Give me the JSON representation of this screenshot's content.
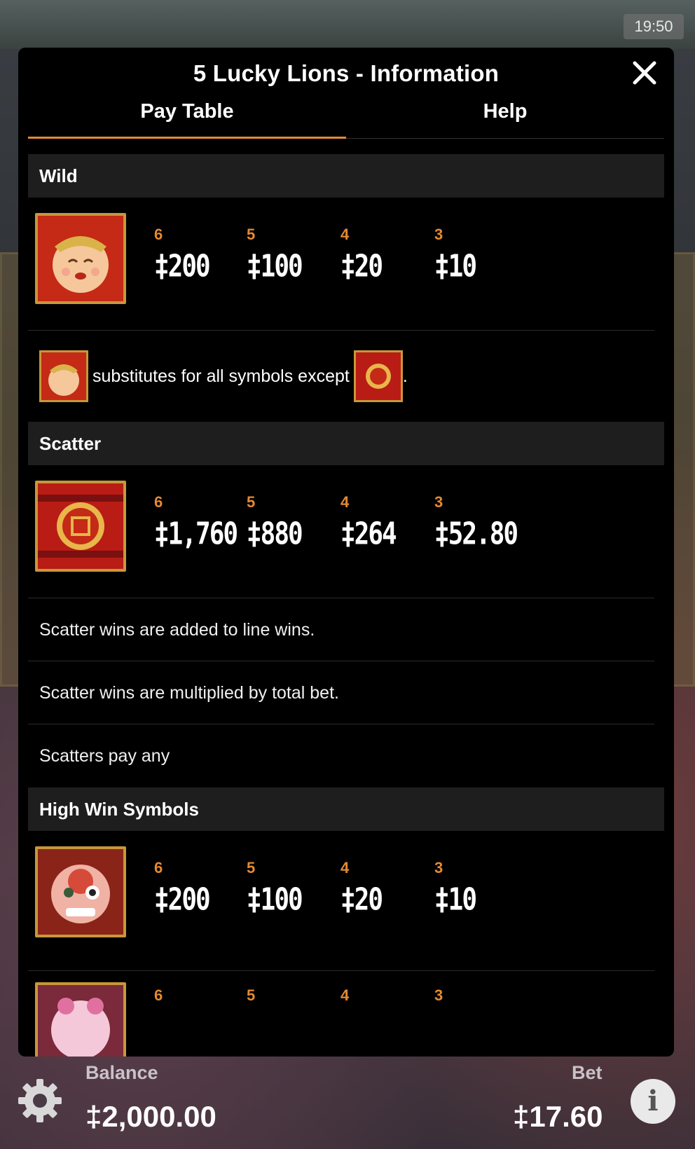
{
  "status_bar": {
    "time": "19:50"
  },
  "dialog": {
    "title": "5 Lucky Lions - Information",
    "tabs": [
      {
        "label": "Pay Table"
      },
      {
        "label": "Help"
      }
    ]
  },
  "sections": {
    "wild": {
      "heading": "Wild",
      "counts": [
        "6",
        "5",
        "4",
        "3"
      ],
      "values": [
        "‡200",
        "‡100",
        "‡20",
        "‡10"
      ],
      "note": "substitutes for all symbols except",
      "note_end": "."
    },
    "scatter": {
      "heading": "Scatter",
      "counts": [
        "6",
        "5",
        "4",
        "3"
      ],
      "values": [
        "‡1,760",
        "‡880",
        "‡264",
        "‡52.80"
      ],
      "notes": [
        "Scatter wins are added to line wins.",
        "Scatter wins are multiplied by total bet.",
        "Scatters pay any"
      ]
    },
    "high_win": {
      "heading": "High Win Symbols",
      "rows": [
        {
          "counts": [
            "6",
            "5",
            "4",
            "3"
          ],
          "values": [
            "‡200",
            "‡100",
            "‡20",
            "‡10"
          ]
        },
        {
          "counts": [
            "6",
            "5",
            "4",
            "3"
          ],
          "values": [
            "",
            "",
            "",
            ""
          ]
        }
      ]
    }
  },
  "footer": {
    "balance_label": "Balance",
    "balance_value": "‡2,000.00",
    "bet_label": "Bet",
    "bet_value": "‡17.60",
    "info_glyph": "i"
  },
  "icons": [
    "gear-icon",
    "info-icon",
    "close-icon",
    "wild-symbol-icon",
    "scatter-symbol-icon",
    "lion-symbol-icon"
  ],
  "colors": {
    "accent": "#e38a32",
    "panel": "#000000",
    "section": "#1e1e1e",
    "frame": "#c8973a"
  }
}
